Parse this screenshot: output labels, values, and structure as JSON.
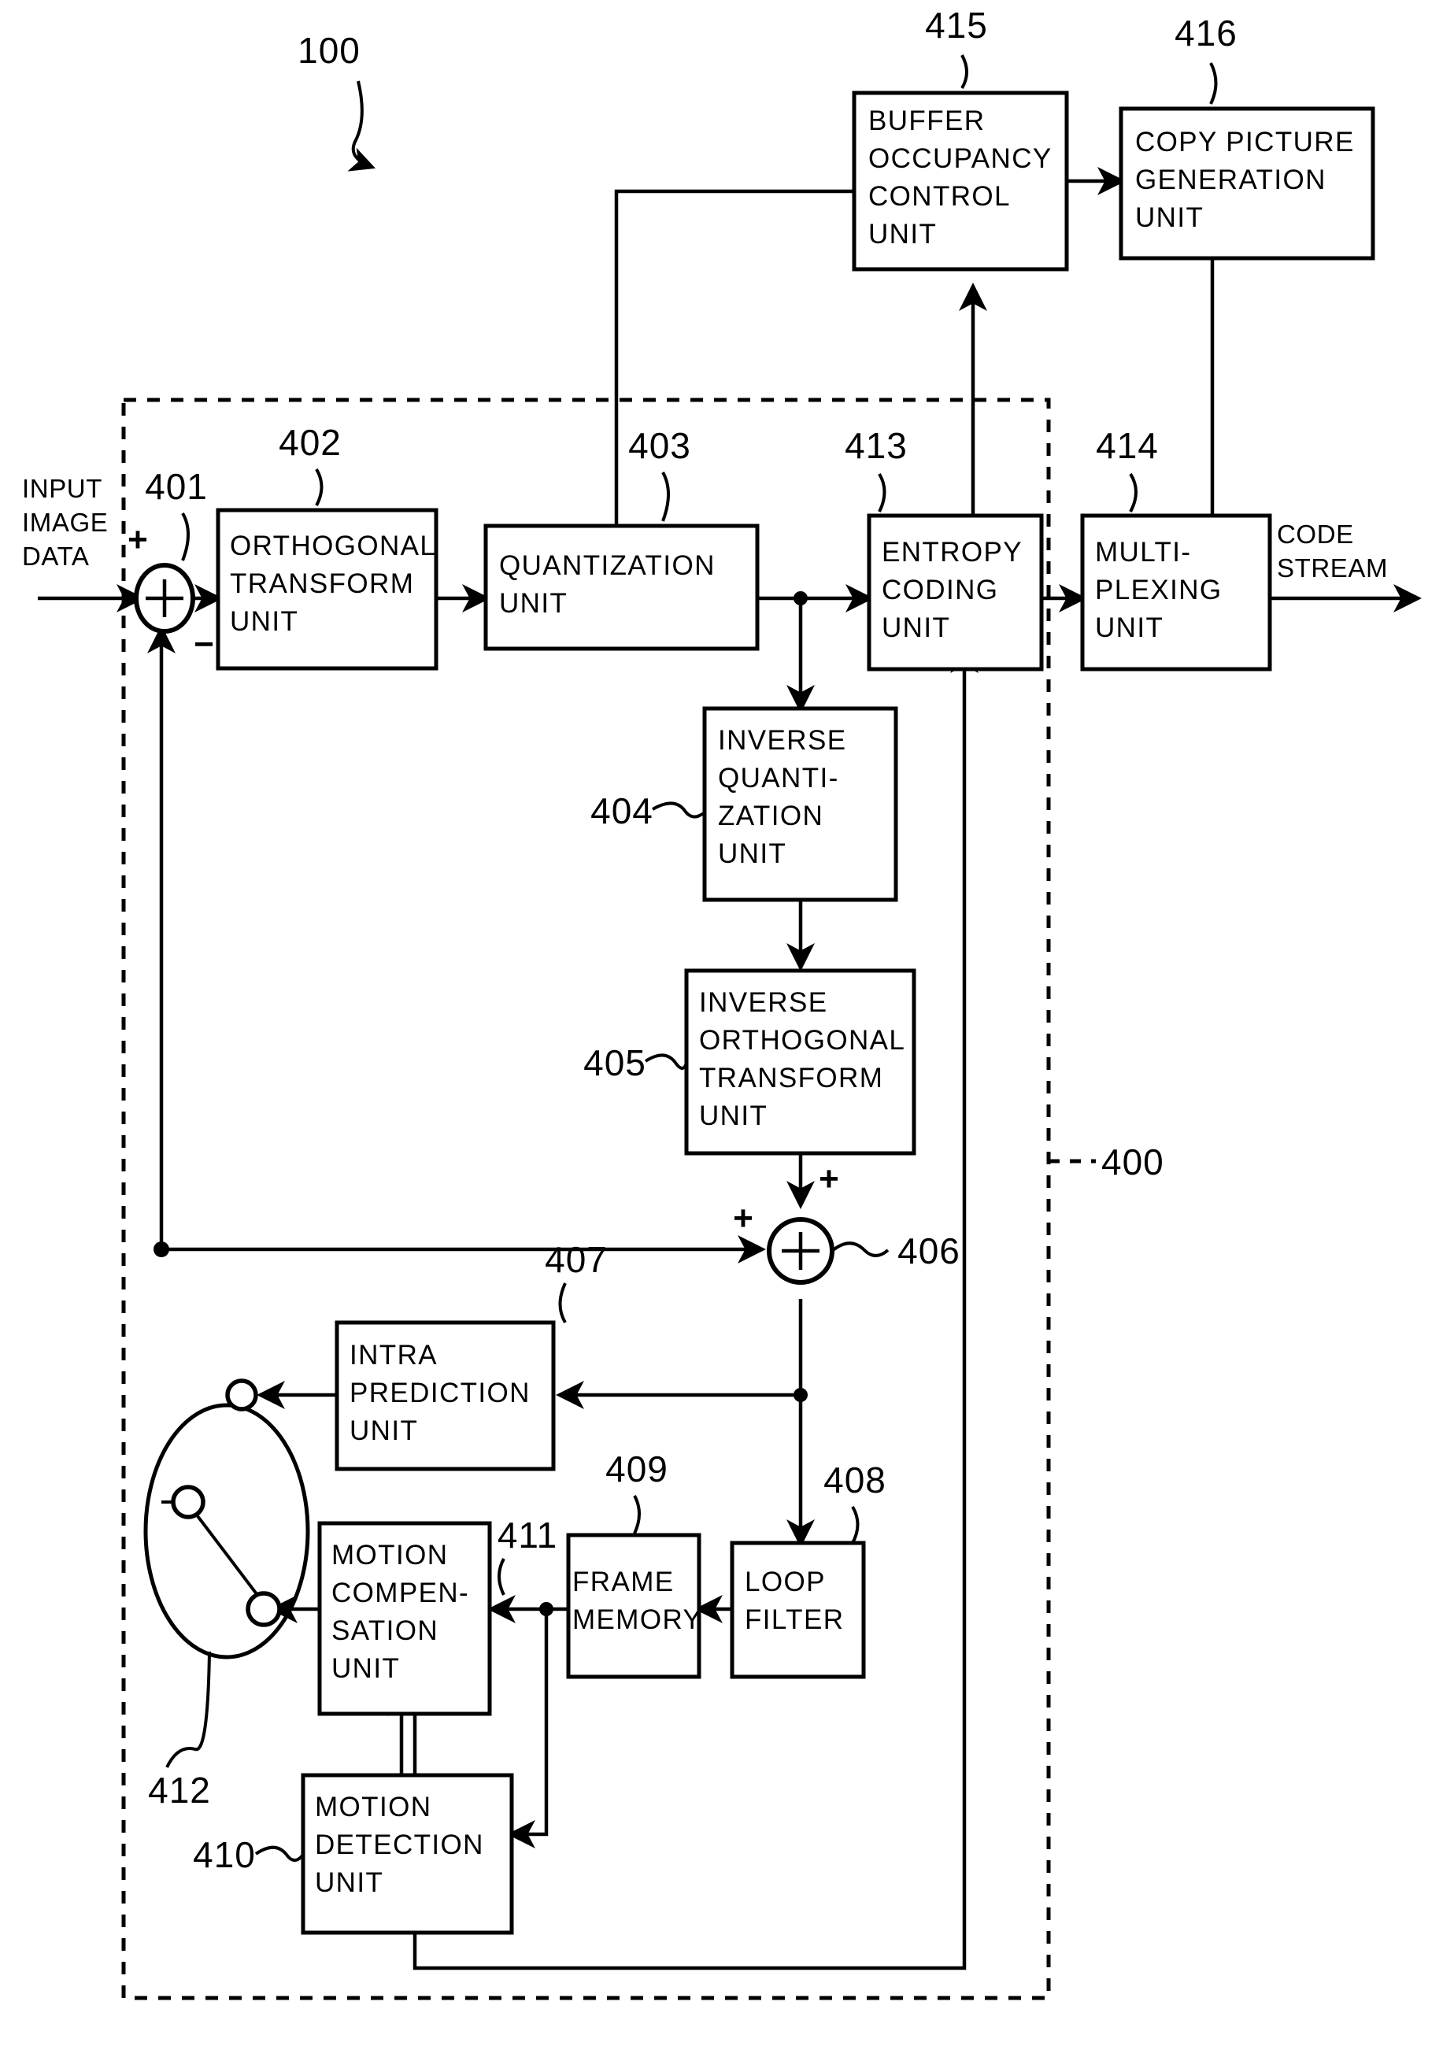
{
  "figure": {
    "title": "100",
    "dashed_group_ref": "400"
  },
  "io_labels": {
    "input": [
      "INPUT",
      "IMAGE",
      "DATA"
    ],
    "output": [
      "CODE",
      "STREAM"
    ]
  },
  "signs": {
    "adder401_plus": "+",
    "adder401_minus": "−",
    "adder406_plus_top": "+",
    "adder406_plus_left": "+"
  },
  "blocks": [
    {
      "id": "buffer-occupancy-control-unit",
      "ref": "415",
      "lines": [
        "BUFFER",
        "OCCUPANCY",
        "CONTROL",
        "UNIT"
      ]
    },
    {
      "id": "copy-picture-generation-unit",
      "ref": "416",
      "lines": [
        "COPY PICTURE",
        "GENERATION",
        "UNIT"
      ]
    },
    {
      "id": "orthogonal-transform-unit",
      "ref": "402",
      "lines": [
        "ORTHOGONAL",
        "TRANSFORM",
        "UNIT"
      ]
    },
    {
      "id": "quantization-unit",
      "ref": "403",
      "lines": [
        "QUANTIZATION",
        "UNIT"
      ]
    },
    {
      "id": "entropy-coding-unit",
      "ref": "413",
      "lines": [
        "ENTROPY",
        "CODING",
        "UNIT"
      ]
    },
    {
      "id": "multiplexing-unit",
      "ref": "414",
      "lines": [
        "MULTI-",
        "PLEXING",
        "UNIT"
      ]
    },
    {
      "id": "inverse-quantization-unit",
      "ref": "404",
      "lines": [
        "INVERSE",
        "QUANTI-",
        "ZATION",
        "UNIT"
      ]
    },
    {
      "id": "inverse-orthogonal-transform-unit",
      "ref": "405",
      "lines": [
        "INVERSE",
        "ORTHOGONAL",
        "TRANSFORM",
        "UNIT"
      ]
    },
    {
      "id": "intra-prediction-unit",
      "ref": "407",
      "lines": [
        "INTRA",
        "PREDICTION",
        "UNIT"
      ]
    },
    {
      "id": "loop-filter",
      "ref": "408",
      "lines": [
        "LOOP",
        "FILTER"
      ]
    },
    {
      "id": "frame-memory",
      "ref": "409",
      "lines": [
        "FRAME",
        "MEMORY"
      ]
    },
    {
      "id": "motion-detection-unit",
      "ref": "410",
      "lines": [
        "MOTION",
        "DETECTION",
        "UNIT"
      ]
    },
    {
      "id": "motion-compensation-unit",
      "ref": "411",
      "lines": [
        "MOTION",
        "COMPEN-",
        "SATION",
        "UNIT"
      ]
    }
  ],
  "operators": [
    {
      "id": "adder-401",
      "ref": "401",
      "glyph": "+"
    },
    {
      "id": "adder-406",
      "ref": "406",
      "glyph": "+"
    }
  ],
  "switch": {
    "id": "prediction-mode-switch",
    "ref": "412"
  },
  "colors": {
    "line": "#000000",
    "background": "#ffffff",
    "block_fill": "#ffffff"
  }
}
